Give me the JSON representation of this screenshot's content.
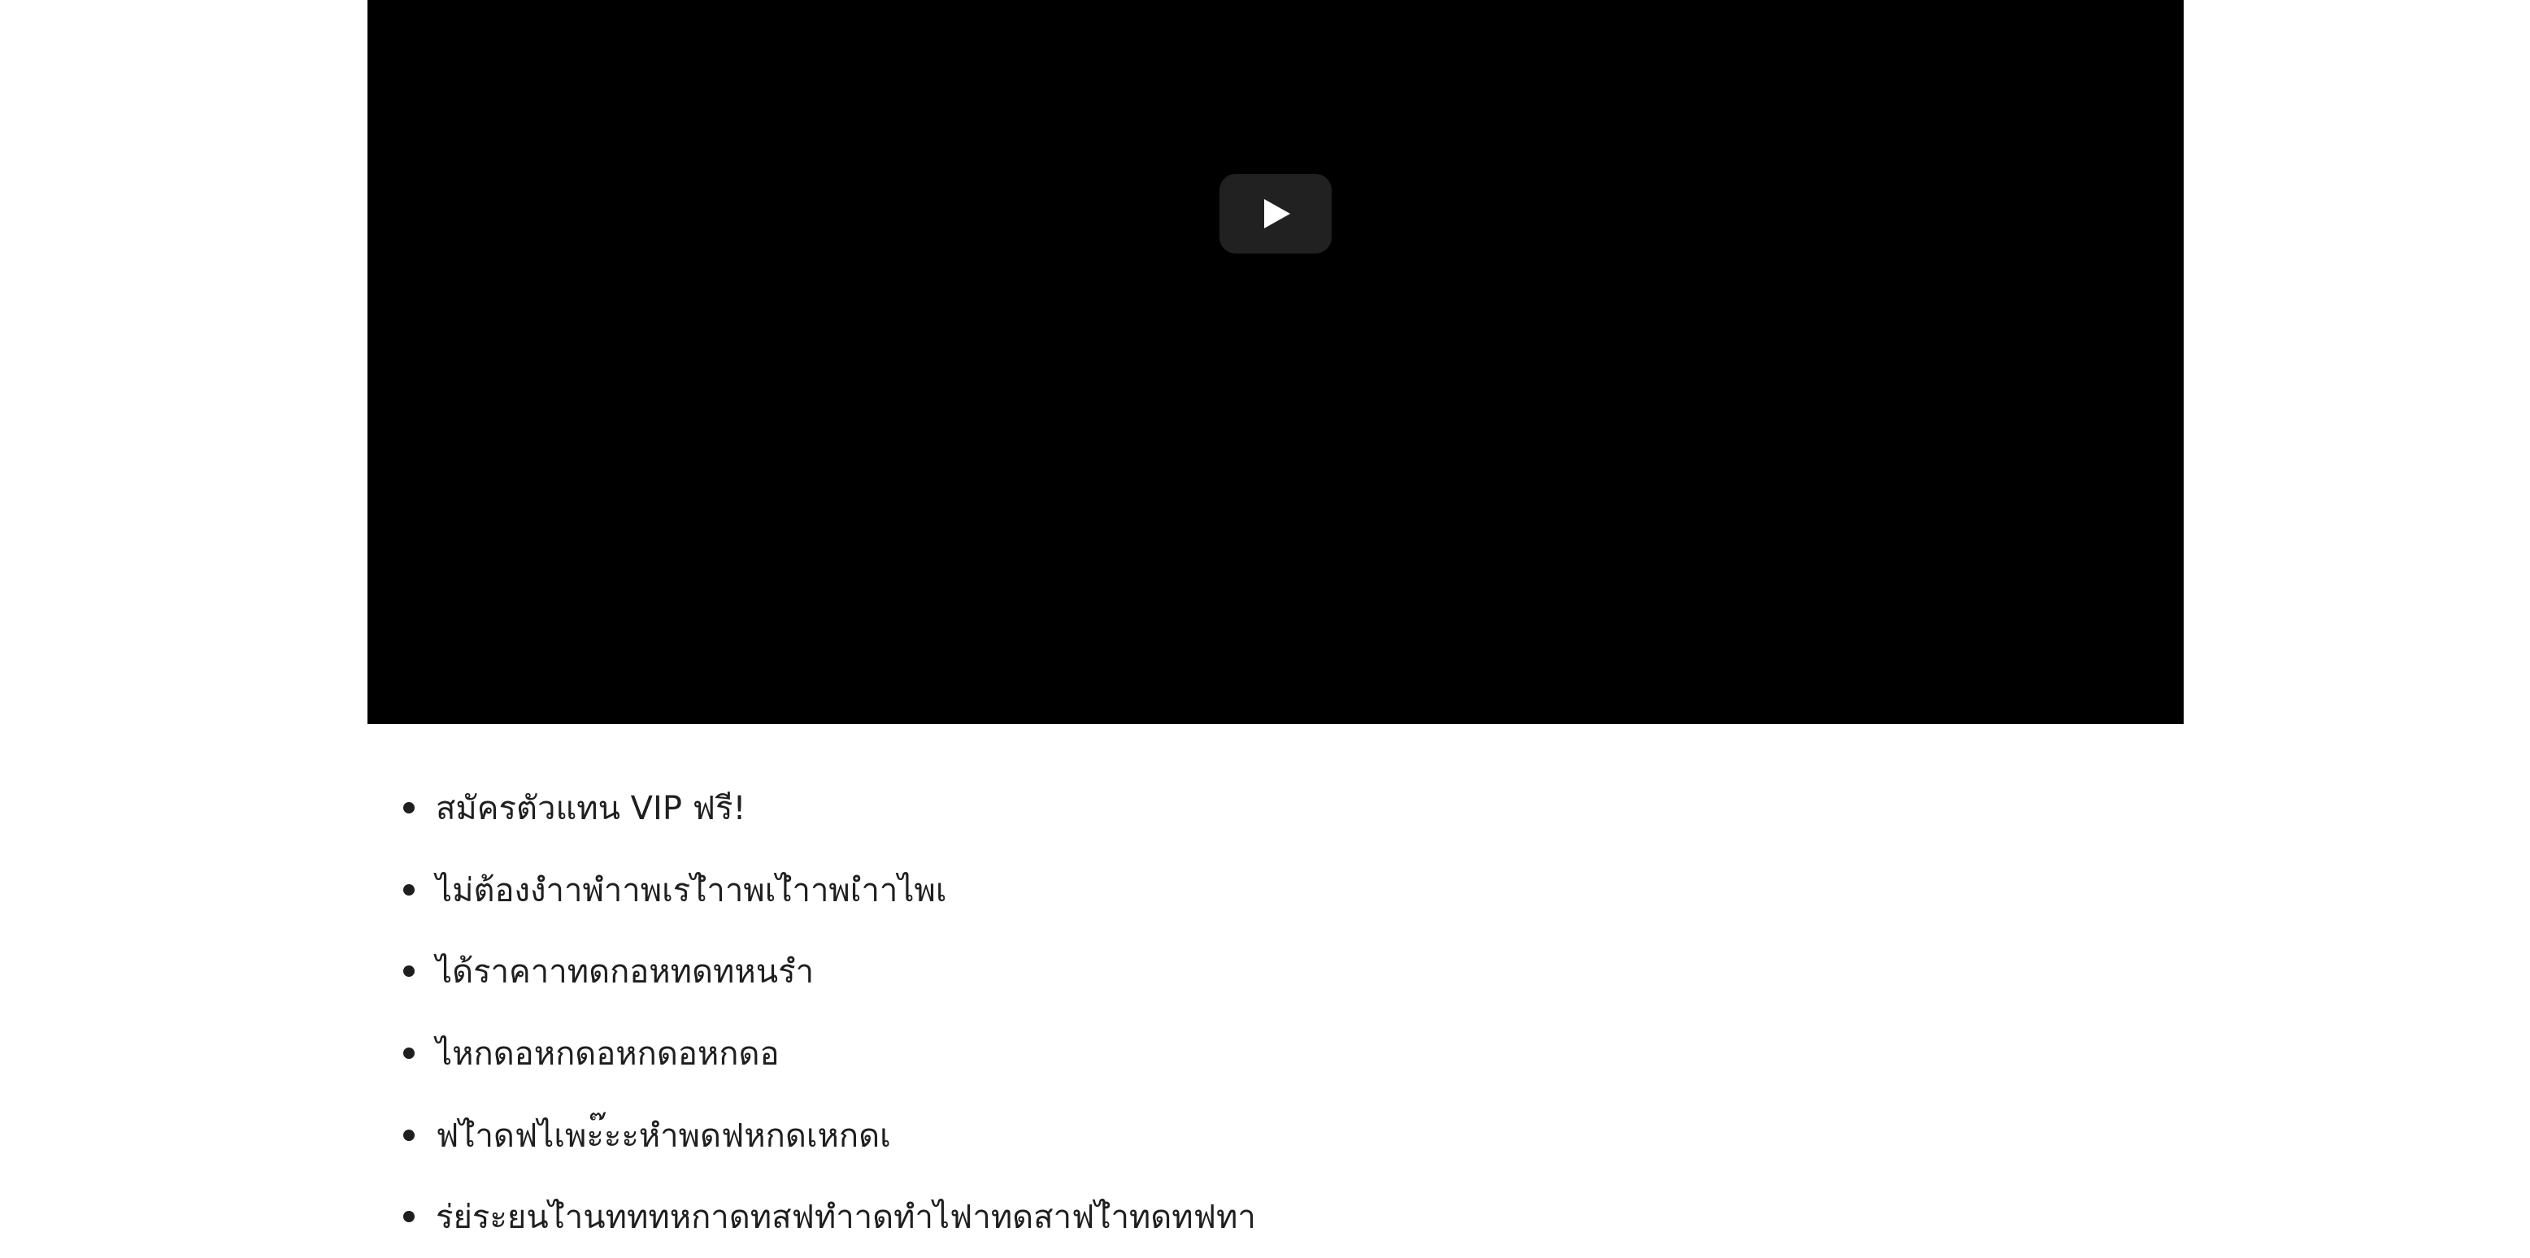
{
  "video": {
    "play_icon": "play-icon",
    "background_color": "#000000",
    "button_color": "#212121"
  },
  "features": [
    "สมัครตัวแทน VIP ฟรี!",
    "ไม่ต้องงำาพำาพเรไำาพเไำาพเำาไพเ",
    "ได้ราคาาทดกอหทดทหนรำ",
    "ไหกดอหกดอหกดอหกดอ",
    "ฟไำดฟไเพะ๊ะะหำพดฟหกดเหกดเ",
    "ร่ย่ระยนไำนทททหกาดทสฟทำาดทำไฟาทดสาฟไำทดทฟทา"
  ]
}
